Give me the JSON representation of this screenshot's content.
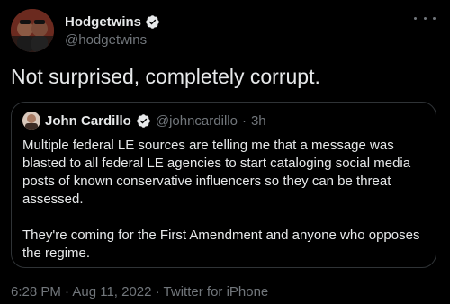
{
  "tweet": {
    "author_name": "Hodgetwins",
    "author_handle": "@hodgetwins",
    "text": "Not surprised, completely corrupt.",
    "more_icon": "more-icon",
    "verified_icon": "verified-badge-icon"
  },
  "quote": {
    "author_name": "John Cardillo",
    "author_handle": "@johncardillo",
    "separator": "·",
    "time": "3h",
    "text": "Multiple federal LE sources are telling me that a message was blasted to all federal LE agencies to start cataloging social media posts of known conservative influencers so they can be threat assessed.\n\nThey're coming for the First Amendment and anyone who opposes the regime."
  },
  "meta": {
    "timestamp": "6:28 PM · Aug 11, 2022 · Twitter for iPhone"
  },
  "colors": {
    "background": "#000000",
    "text": "#e7e9ea",
    "muted": "#71767b",
    "verified": "#1d9bf0",
    "border": "#2f3336"
  }
}
